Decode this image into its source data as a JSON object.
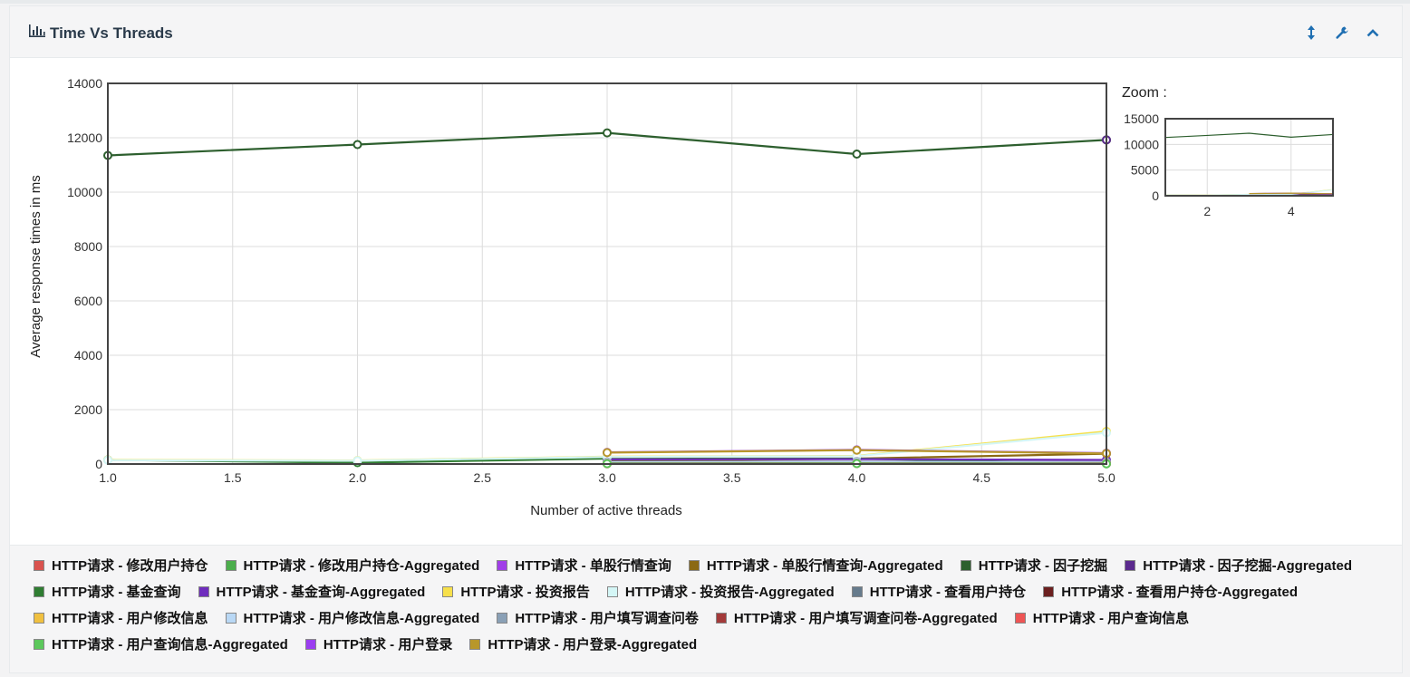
{
  "panel": {
    "title": "Time Vs Threads"
  },
  "icons": {
    "chart": "bar-chart-icon",
    "expand": "expand-vertical-icon",
    "settings": "wrench-icon",
    "collapse": "chevron-up-icon"
  },
  "zoom": {
    "label": "Zoom :"
  },
  "chart_data": {
    "type": "line",
    "xlabel": "Number of active threads",
    "ylabel": "Average response times in ms",
    "xlim": [
      1.0,
      5.0
    ],
    "ylim": [
      0,
      14000
    ],
    "x_ticks": [
      "1.0",
      "1.5",
      "2.0",
      "2.5",
      "3.0",
      "3.5",
      "4.0",
      "4.5",
      "5.0"
    ],
    "y_ticks": [
      "0",
      "2000",
      "4000",
      "6000",
      "8000",
      "10000",
      "12000",
      "14000"
    ],
    "grid": true,
    "series": [
      {
        "name": "HTTP请求 - 修改用户持仓",
        "color": "#d9534f",
        "points": [
          [
            3,
            10
          ],
          [
            4,
            20
          ],
          [
            5,
            15
          ]
        ]
      },
      {
        "name": "HTTP请求 - 修改用户持仓-Aggregated",
        "color": "#4cae4c",
        "points": [
          [
            3,
            12
          ],
          [
            4,
            22
          ],
          [
            5,
            18
          ]
        ]
      },
      {
        "name": "HTTP请求 - 单股行情查询",
        "color": "#a13ee8",
        "points": [
          [
            3,
            50
          ],
          [
            4,
            80
          ],
          [
            5,
            60
          ]
        ]
      },
      {
        "name": "HTTP请求 - 单股行情查询-Aggregated",
        "color": "#8b6914",
        "points": [
          [
            3,
            100
          ],
          [
            4,
            200
          ],
          [
            5,
            380
          ]
        ]
      },
      {
        "name": "HTTP请求 - 因子挖掘",
        "color": "#2d5f2e",
        "points": [
          [
            1,
            11350
          ],
          [
            2,
            11750
          ],
          [
            3,
            12180
          ],
          [
            4,
            11400
          ],
          [
            5,
            11920
          ]
        ]
      },
      {
        "name": "HTTP请求 - 因子挖掘-Aggregated",
        "color": "#5b2a8e",
        "points": [
          [
            5,
            11920
          ]
        ]
      },
      {
        "name": "HTTP请求 - 基金查询",
        "color": "#2f7d32",
        "points": [
          [
            1,
            150
          ],
          [
            2,
            50
          ],
          [
            3,
            200
          ],
          [
            4,
            200
          ],
          [
            5,
            10
          ]
        ]
      },
      {
        "name": "HTTP请求 - 基金查询-Aggregated",
        "color": "#6f2dbd",
        "points": [
          [
            3,
            170
          ],
          [
            4,
            180
          ],
          [
            5,
            150
          ]
        ]
      },
      {
        "name": "HTTP请求 - 投资报告",
        "color": "#f7e04b",
        "points": [
          [
            1,
            150
          ],
          [
            2,
            130
          ],
          [
            3,
            270
          ],
          [
            4,
            300
          ],
          [
            5,
            1200
          ]
        ]
      },
      {
        "name": "HTTP请求 - 投资报告-Aggregated",
        "color": "#d4f6f6",
        "points": [
          [
            1,
            140
          ],
          [
            2,
            120
          ],
          [
            3,
            260
          ],
          [
            4,
            290
          ],
          [
            5,
            1150
          ]
        ]
      },
      {
        "name": "HTTP请求 - 查看用户持仓",
        "color": "#667b8c",
        "points": [
          [
            3,
            80
          ],
          [
            4,
            90
          ],
          [
            5,
            70
          ]
        ]
      },
      {
        "name": "HTTP请求 - 查看用户持仓-Aggregated",
        "color": "#6b1f1f",
        "points": [
          [
            3,
            40
          ],
          [
            4,
            45
          ],
          [
            5,
            35
          ]
        ]
      },
      {
        "name": "HTTP请求 - 用户修改信息",
        "color": "#f0c040",
        "points": [
          [
            3,
            60
          ],
          [
            4,
            70
          ],
          [
            5,
            50
          ]
        ]
      },
      {
        "name": "HTTP请求 - 用户修改信息-Aggregated",
        "color": "#b9d8f5",
        "points": [
          [
            3,
            65
          ],
          [
            4,
            75
          ],
          [
            5,
            55
          ]
        ]
      },
      {
        "name": "HTTP请求 - 用户填写调查问卷",
        "color": "#8aa0b6",
        "points": [
          [
            3,
            30
          ],
          [
            4,
            35
          ],
          [
            5,
            25
          ]
        ]
      },
      {
        "name": "HTTP请求 - 用户填写调查问卷-Aggregated",
        "color": "#a33a3a",
        "points": [
          [
            3,
            20
          ],
          [
            4,
            25
          ],
          [
            5,
            20
          ]
        ]
      },
      {
        "name": "HTTP请求 - 用户查询信息",
        "color": "#ee5555",
        "points": [
          [
            3,
            15
          ],
          [
            4,
            18
          ],
          [
            5,
            12
          ]
        ]
      },
      {
        "name": "HTTP请求 - 用户查询信息-Aggregated",
        "color": "#5cc85c",
        "points": [
          [
            3,
            14
          ],
          [
            4,
            16
          ],
          [
            5,
            10
          ]
        ]
      },
      {
        "name": "HTTP请求 - 用户登录",
        "color": "#9b3ef0",
        "points": [
          [
            3,
            430
          ],
          [
            4,
            520
          ],
          [
            5,
            400
          ]
        ]
      },
      {
        "name": "HTTP请求 - 用户登录-Aggregated",
        "color": "#b8972a",
        "points": [
          [
            3,
            420
          ],
          [
            4,
            510
          ],
          [
            5,
            390
          ]
        ]
      }
    ],
    "zoom_chart": {
      "x_ticks": [
        "2",
        "4"
      ],
      "y_ticks": [
        "0",
        "5000",
        "10000",
        "15000"
      ],
      "xlim": [
        1,
        5
      ],
      "ylim": [
        0,
        15000
      ]
    }
  }
}
